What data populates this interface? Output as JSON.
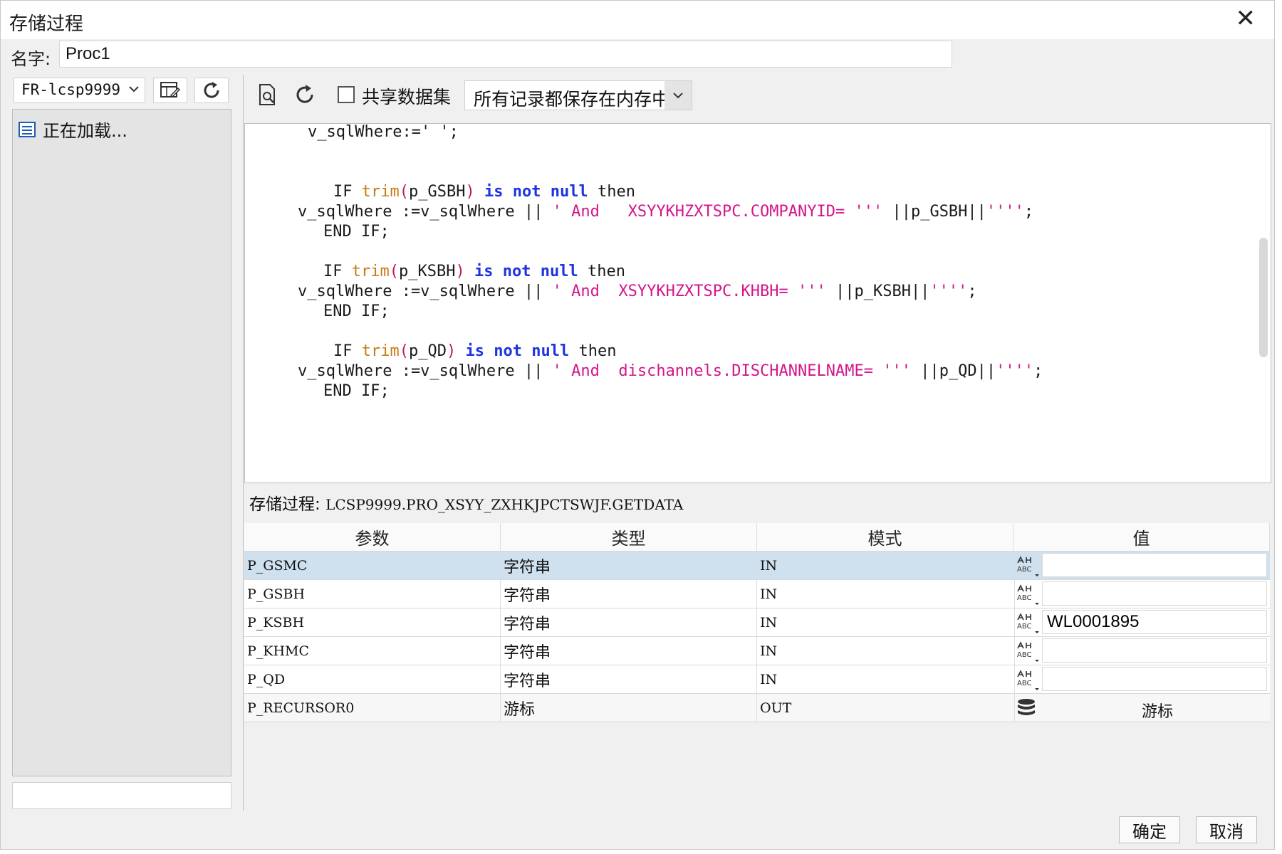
{
  "window": {
    "title": "存储过程",
    "close_glyph": "✕"
  },
  "name_row": {
    "label": "名字:",
    "value": "Proc1"
  },
  "left": {
    "datasource": "FR-lcsp9999",
    "tree_item": "正在加载..."
  },
  "toolbar": {
    "share_label": "共享数据集",
    "mode_value": "所有记录都保存在内存中"
  },
  "code": {
    "l1": "v_sqlWhere:=' ';",
    "b1": {
      "if": "IF",
      "trim": "trim",
      "lp": "(",
      "arg": "p_GSBH",
      "rp": ")",
      "is": "is",
      "not": "not",
      "null": "null",
      "then": "then",
      "assign": "v_sqlWhere :=v_sqlWhere || ",
      "str": "' And   XSYYKHZXTSPC.COMPANYID= '''",
      "tail": " ||p_GSBH||",
      "str2": "''''",
      "semi": ";",
      "end": "END IF;"
    },
    "b2": {
      "if": "IF",
      "trim": "trim",
      "lp": "(",
      "arg": "p_KSBH",
      "rp": ")",
      "is": "is",
      "not": "not",
      "null": "null",
      "then": "then",
      "assign": "v_sqlWhere :=v_sqlWhere || ",
      "str": "' And  XSYYKHZXTSPC.KHBH= '''",
      "tail": " ||p_KSBH||",
      "str2": "''''",
      "semi": ";",
      "end": "END IF;"
    },
    "b3": {
      "if": "IF",
      "trim": "trim",
      "lp": "(",
      "arg": "p_QD",
      "rp": ")",
      "is": "is",
      "not": "not",
      "null": "null",
      "then": "then",
      "assign": "v_sqlWhere :=v_sqlWhere || ",
      "str": "' And  dischannels.DISCHANNELNAME= '''",
      "tail": " ||p_QD||",
      "str2": "''''",
      "semi": ";",
      "end": "END IF;"
    }
  },
  "proc": {
    "label": "存储过程:",
    "name": "LCSP9999.PRO_XSYY_ZXHKJPCTSWJF.GETDATA"
  },
  "params": {
    "headers": [
      "参数",
      "类型",
      "模式",
      "值"
    ],
    "rows": [
      {
        "name": "P_GSMC",
        "type": "字符串",
        "mode": "IN",
        "value": ""
      },
      {
        "name": "P_GSBH",
        "type": "字符串",
        "mode": "IN",
        "value": ""
      },
      {
        "name": "P_KSBH",
        "type": "字符串",
        "mode": "IN",
        "value": "WL0001895"
      },
      {
        "name": "P_KHMC",
        "type": "字符串",
        "mode": "IN",
        "value": ""
      },
      {
        "name": "P_QD",
        "type": "字符串",
        "mode": "IN",
        "value": ""
      },
      {
        "name": "P_RECURSOR0",
        "type": "游标",
        "mode": "OUT",
        "value": "游标"
      }
    ],
    "abc_icon": "ABC"
  },
  "buttons": {
    "ok": "确定",
    "cancel": "取消"
  }
}
